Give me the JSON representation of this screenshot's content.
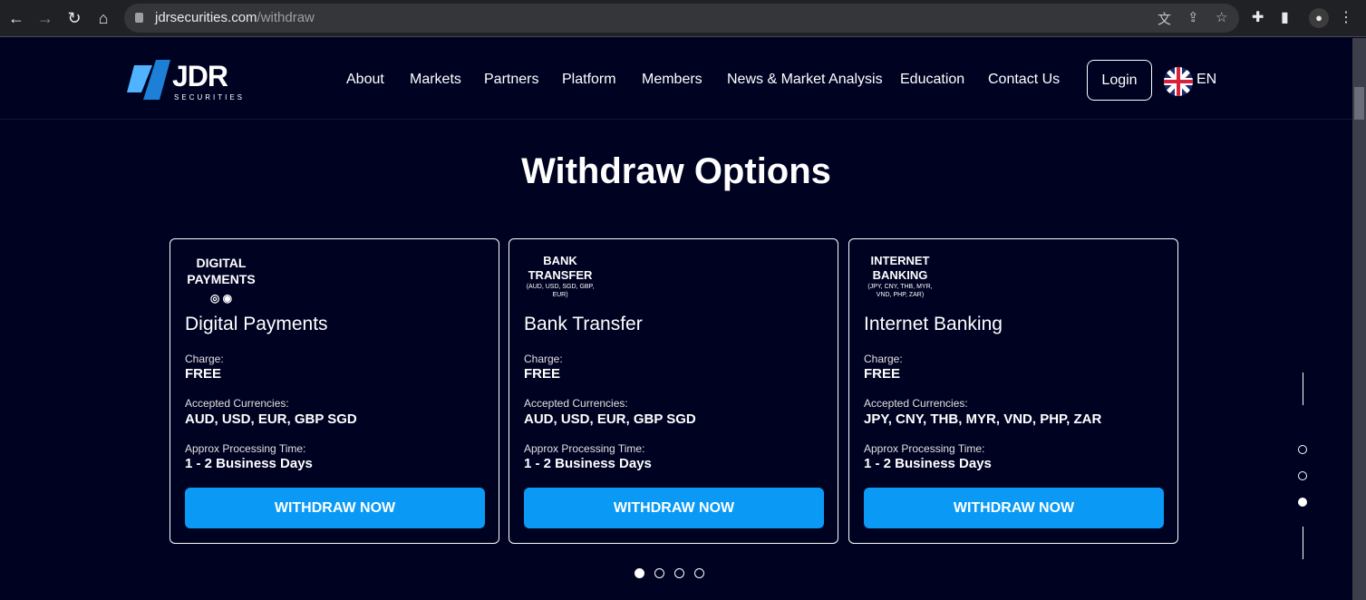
{
  "browser": {
    "url_domain": "jdrsecurities.com",
    "url_path": "/withdraw"
  },
  "header": {
    "logo_text": "JDR",
    "logo_sub": "SECURITIES",
    "nav": [
      "About",
      "Markets",
      "Partners",
      "Platform",
      "Members",
      "News & Market Analysis",
      "Education",
      "Contact Us"
    ],
    "login": "Login",
    "language": "EN"
  },
  "title": "Withdraw Options",
  "cards": [
    {
      "logo_line1": "DIGITAL",
      "logo_line2": "PAYMENTS",
      "logo_small": "",
      "name": "Digital Payments",
      "charge_label": "Charge:",
      "charge": "FREE",
      "currencies_label": "Accepted Currencies:",
      "currencies": "AUD, USD, EUR, GBP SGD",
      "time_label": "Approx Processing Time:",
      "time": "1 - 2 Business Days",
      "button": "WITHDRAW NOW"
    },
    {
      "logo_line1": "BANK",
      "logo_line2": "TRANSFER",
      "logo_small": "(AUD, USD, SGD, GBP, EUR)",
      "name": "Bank Transfer",
      "charge_label": "Charge:",
      "charge": "FREE",
      "currencies_label": "Accepted Currencies:",
      "currencies": "AUD, USD, EUR, GBP SGD",
      "time_label": "Approx Processing Time:",
      "time": "1 - 2 Business Days",
      "button": "WITHDRAW NOW"
    },
    {
      "logo_line1": "INTERNET",
      "logo_line2": "BANKING",
      "logo_small": "(JPY, CNY, THB, MYR, VND, PHP, ZAR)",
      "name": "Internet Banking",
      "charge_label": "Charge:",
      "charge": "FREE",
      "currencies_label": "Accepted Currencies:",
      "currencies": "JPY, CNY, THB, MYR, VND, PHP, ZAR",
      "time_label": "Approx Processing Time:",
      "time": "1 - 2 Business Days",
      "button": "WITHDRAW NOW"
    }
  ],
  "carousel": {
    "pages": 4,
    "active": 1
  },
  "side_pager": {
    "pages": 3,
    "active": 3
  },
  "colors": {
    "background": "#000222",
    "accent": "#0a9af5"
  }
}
